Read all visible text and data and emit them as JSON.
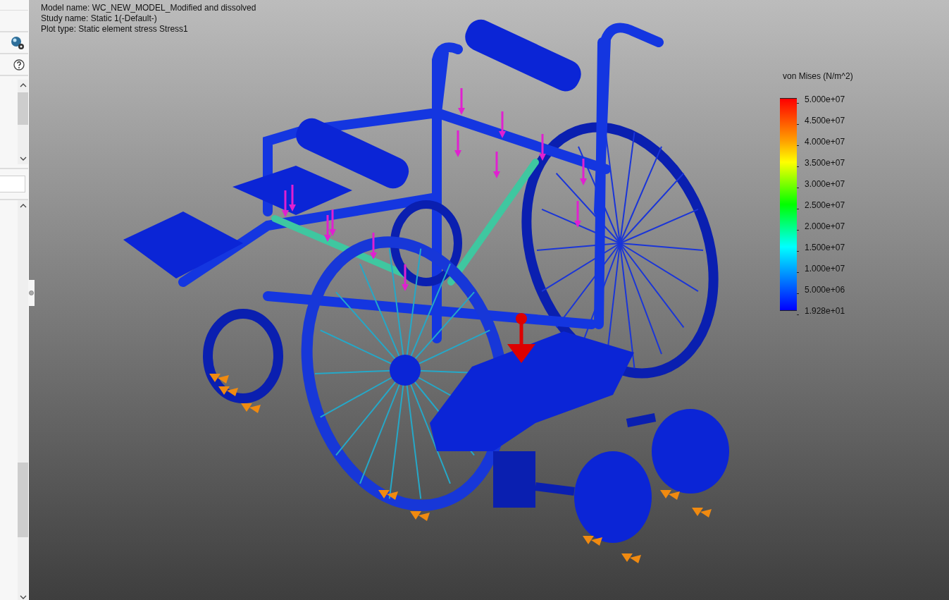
{
  "plot_info": [
    "Model name: WC_NEW_MODEL_Modified and dissolved",
    "Study name: Static 1(-Default-)",
    "Plot type: Static element stress Stress1"
  ],
  "legend": {
    "title": "von Mises (N/m^2)",
    "labels": [
      "5.000e+07",
      "4.500e+07",
      "4.000e+07",
      "3.500e+07",
      "3.000e+07",
      "2.500e+07",
      "2.000e+07",
      "1.500e+07",
      "1.000e+07",
      "5.000e+06",
      "1.928e+01"
    ]
  }
}
